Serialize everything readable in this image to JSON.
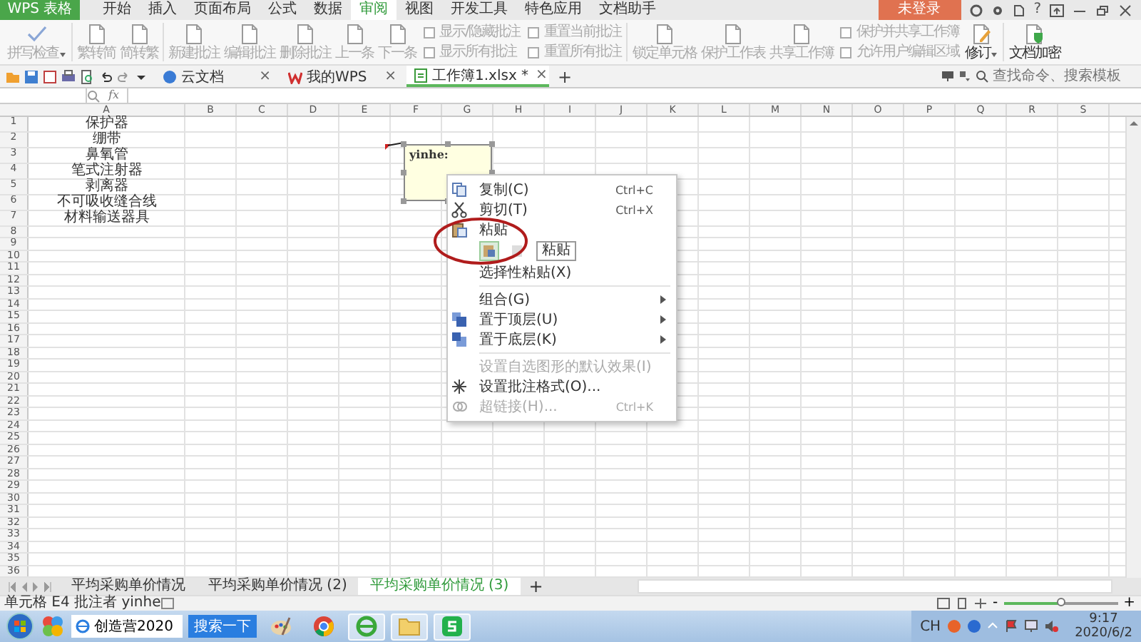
{
  "menubar": {
    "app_button": "WPS 表格",
    "tabs": [
      {
        "label": "开始",
        "selected": false
      },
      {
        "label": "插入",
        "selected": false
      },
      {
        "label": "页面布局",
        "selected": false
      },
      {
        "label": "公式",
        "selected": false
      },
      {
        "label": "数据",
        "selected": false
      },
      {
        "label": "审阅",
        "selected": true
      },
      {
        "label": "视图",
        "selected": false
      },
      {
        "label": "开发工具",
        "selected": false
      },
      {
        "label": "特色应用",
        "selected": false
      },
      {
        "label": "文档助手",
        "selected": false
      }
    ],
    "login_button": "未登录",
    "help": "?"
  },
  "ribbon": {
    "groups": [
      [
        {
          "kind": "spellcheck",
          "label": "拼写检查",
          "dropdown": true,
          "disabled": true
        }
      ],
      [
        {
          "kind": "command",
          "label": "繁转简",
          "dropdown": false,
          "disabled": true
        },
        {
          "kind": "command",
          "label": "简转繁",
          "dropdown": false,
          "disabled": true
        }
      ],
      [
        {
          "kind": "command",
          "label": "新建批注",
          "dropdown": false,
          "disabled": true
        },
        {
          "kind": "command",
          "label": "编辑批注",
          "dropdown": false,
          "disabled": true
        },
        {
          "kind": "command",
          "label": "删除批注",
          "dropdown": false,
          "disabled": true
        },
        {
          "kind": "command",
          "label": "上一条",
          "dropdown": false,
          "disabled": true
        },
        {
          "kind": "command",
          "label": "下一条",
          "dropdown": false,
          "disabled": true
        },
        {
          "kind": "stack",
          "items": [
            {
              "label": "显示/隐藏批注",
              "disabled": true
            },
            {
              "label": "显示所有批注",
              "disabled": true
            }
          ]
        },
        {
          "kind": "stack",
          "items": [
            {
              "label": "重置当前批注",
              "disabled": true
            },
            {
              "label": "重置所有批注",
              "disabled": true
            }
          ]
        }
      ],
      [
        {
          "kind": "command",
          "label": "锁定单元格",
          "dropdown": false,
          "disabled": true
        },
        {
          "kind": "command",
          "label": "保护工作表",
          "dropdown": false,
          "disabled": true
        },
        {
          "kind": "command",
          "label": "共享工作簿",
          "dropdown": false,
          "disabled": true
        },
        {
          "kind": "stack",
          "items": [
            {
              "label": "保护并共享工作簿",
              "disabled": true
            },
            {
              "label": "允许用户编辑区域",
              "disabled": true
            }
          ]
        },
        {
          "kind": "revision",
          "label": "修订",
          "dropdown": true,
          "disabled": false
        }
      ],
      [
        {
          "kind": "encrypt",
          "label": "文档加密",
          "dropdown": false,
          "disabled": false
        }
      ]
    ]
  },
  "docbar": {
    "tabs": [
      {
        "kind": "cloud",
        "label": "云文档",
        "selected": false,
        "close": "×"
      },
      {
        "kind": "home",
        "label": "我的WPS",
        "selected": false,
        "close": "×"
      },
      {
        "kind": "workbook",
        "label": "工作簿1.xlsx *",
        "selected": true,
        "close": "×"
      }
    ],
    "new_tab": "+",
    "search": {
      "placeholder": "查找命令、搜索模板"
    }
  },
  "formula_bar": {
    "fx": "fx"
  },
  "sheet": {
    "columns": [
      "A",
      "B",
      "C",
      "D",
      "E",
      "F",
      "G",
      "H",
      "I",
      "J",
      "K",
      "L",
      "M",
      "N",
      "O",
      "P",
      "Q",
      "R",
      "S"
    ],
    "rows": [
      {
        "number": "1",
        "cells": [
          "保护器"
        ]
      },
      {
        "number": "2",
        "cells": [
          "绷带"
        ]
      },
      {
        "number": "3",
        "cells": [
          "鼻氧管"
        ]
      },
      {
        "number": "4",
        "cells": [
          "笔式注射器"
        ]
      },
      {
        "number": "5",
        "cells": [
          "剥离器"
        ]
      },
      {
        "number": "6",
        "cells": [
          "不可吸收缝合线"
        ]
      },
      {
        "number": "7",
        "cells": [
          "材料输送器具"
        ]
      },
      {
        "number": "8"
      },
      {
        "number": "9"
      },
      {
        "number": "10"
      },
      {
        "number": "11"
      },
      {
        "number": "12"
      },
      {
        "number": "13"
      },
      {
        "number": "14"
      },
      {
        "number": "15"
      },
      {
        "number": "16"
      },
      {
        "number": "17"
      },
      {
        "number": "18"
      },
      {
        "number": "19"
      },
      {
        "number": "20"
      },
      {
        "number": "21"
      },
      {
        "number": "22"
      },
      {
        "number": "23"
      },
      {
        "number": "24"
      },
      {
        "number": "25"
      },
      {
        "number": "26"
      },
      {
        "number": "27"
      },
      {
        "number": "28"
      },
      {
        "number": "29"
      },
      {
        "number": "30"
      },
      {
        "number": "31"
      },
      {
        "number": "32"
      },
      {
        "number": "33"
      },
      {
        "number": "34"
      },
      {
        "number": "35"
      },
      {
        "number": "36"
      }
    ],
    "comment": {
      "author": "yinhe:"
    }
  },
  "context_menu": {
    "items": [
      {
        "kind": "copy",
        "label": "复制(C)",
        "shortcut": "Ctrl+C",
        "submenu": false,
        "disabled": false
      },
      {
        "kind": "cut",
        "label": "剪切(T)",
        "shortcut": "Ctrl+X",
        "submenu": false,
        "disabled": false
      },
      {
        "kind": "paste",
        "label": "粘贴",
        "submenu": false,
        "disabled": false
      },
      {
        "kind": "paste_options",
        "tooltip": "粘贴"
      },
      {
        "kind": "plain",
        "label": "选择性粘贴(X)",
        "submenu": false,
        "disabled": false
      },
      {
        "kind": "separator"
      },
      {
        "kind": "plain",
        "label": "组合(G)",
        "submenu": true,
        "disabled": false
      },
      {
        "kind": "front",
        "label": "置于顶层(U)",
        "submenu": true,
        "disabled": false
      },
      {
        "kind": "back",
        "label": "置于底层(K)",
        "submenu": true,
        "disabled": false
      },
      {
        "kind": "separator"
      },
      {
        "kind": "plain",
        "label": "设置自选图形的默认效果(I)",
        "submenu": false,
        "disabled": true
      },
      {
        "kind": "format",
        "label": "设置批注格式(O)...",
        "submenu": false,
        "disabled": false
      },
      {
        "kind": "link",
        "label": "超链接(H)...",
        "shortcut": "Ctrl+K",
        "submenu": false,
        "disabled": true
      }
    ]
  },
  "sheet_tabs": {
    "tabs": [
      {
        "label": "平均采购单价情况",
        "selected": false
      },
      {
        "label": "平均采购单价情况 (2)",
        "selected": false
      },
      {
        "label": "平均采购单价情况 (3)",
        "selected": true
      }
    ],
    "add": "+"
  },
  "status_bar": {
    "text": "单元格 E4 批注者 yinhe",
    "zoom": {
      "out": "-",
      "in": "+",
      "level": 0.5
    }
  },
  "taskbar": {
    "search": {
      "value": "创造营2020"
    },
    "search_button": "搜索一下",
    "tray": {
      "input": "CH",
      "time": "9:17",
      "date": "2020/6/2"
    }
  }
}
